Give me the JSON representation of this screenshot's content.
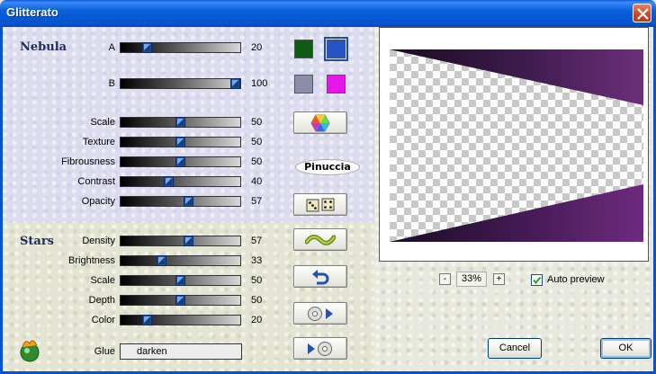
{
  "window": {
    "title": "Glitterato"
  },
  "nebula": {
    "section_label": "Nebula",
    "sliders": [
      {
        "label": "A",
        "value": "20"
      },
      {
        "label": "B",
        "value": "100"
      },
      {
        "label": "Scale",
        "value": "50"
      },
      {
        "label": "Texture",
        "value": "50"
      },
      {
        "label": "Fibrousness",
        "value": "50"
      },
      {
        "label": "Contrast",
        "value": "40"
      },
      {
        "label": "Opacity",
        "value": "57"
      }
    ]
  },
  "stars": {
    "section_label": "Stars",
    "sliders": [
      {
        "label": "Density",
        "value": "57"
      },
      {
        "label": "Brightness",
        "value": "33"
      },
      {
        "label": "Scale",
        "value": "50"
      },
      {
        "label": "Depth",
        "value": "50"
      },
      {
        "label": "Color",
        "value": "20"
      }
    ]
  },
  "glue": {
    "label": "Glue",
    "value": "darken"
  },
  "colors": {
    "swatch_a_primary": "#0f5a14",
    "swatch_a_secondary": "#2852c8",
    "swatch_b_primary": "#8a8ea8",
    "swatch_b_secondary": "#e417e6"
  },
  "tool_buttons": [
    {
      "icon": "color-hexagon-icon"
    },
    {
      "icon": "dice-icon"
    },
    {
      "icon": "wave-icon"
    },
    {
      "icon": "undo-icon"
    },
    {
      "icon": "save-preset-icon"
    },
    {
      "icon": "load-preset-icon"
    }
  ],
  "logo_text": "Pinuccia",
  "zoom": {
    "minus": "-",
    "value": "33%",
    "plus": "+"
  },
  "auto_preview": {
    "label": "Auto preview",
    "checked": true
  },
  "buttons": {
    "cancel": "Cancel",
    "ok": "OK"
  }
}
